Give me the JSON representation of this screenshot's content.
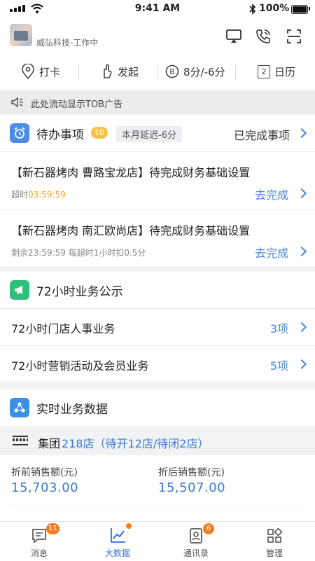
{
  "status_bar": {
    "time": "9:41 AM",
    "battery": "100%"
  },
  "header": {
    "company_status": "威弘科技-工作中"
  },
  "quick_actions": [
    {
      "label": "打卡",
      "icon": "location-pin-icon"
    },
    {
      "label": "发起",
      "icon": "hand-up-icon"
    },
    {
      "label": "8分/-6分",
      "icon": "score-coin-icon"
    },
    {
      "label": "日历",
      "icon": "calendar-icon"
    }
  ],
  "calendar_day": "2",
  "notice": {
    "text": "此处流动显示TOB广告"
  },
  "todo": {
    "title": "待办事项",
    "count": "10",
    "delay_tag": "本月延迟-6分",
    "completed_link": "已完成事项",
    "items": [
      {
        "title": "【新石器烤肉 曹路宝龙店】待完成财务基础设置",
        "status_prefix": "超时",
        "status_time": "03:59:59",
        "status_suffix": "",
        "action": "去完成"
      },
      {
        "title": "【新石器烤肉 南汇欧尚店】待完成财务基础设置",
        "status_prefix": "剩余23:59:59 每超时1小时扣0.5分",
        "status_time": "",
        "status_suffix": "",
        "action": "去完成"
      }
    ]
  },
  "announcement": {
    "title": "72小时业务公示",
    "items": [
      {
        "label": "72小时门店人事业务",
        "count": "3项"
      },
      {
        "label": "72小时营销活动及会员业务",
        "count": "5项"
      }
    ]
  },
  "realtime": {
    "title": "实时业务数据",
    "group_prefix": "集团",
    "group_stores": "218店（待开12店/待闭2店）",
    "metrics": [
      {
        "label": "折前销售额(元)",
        "value": "15,703.00"
      },
      {
        "label": "折后销售额(元)",
        "value": "15,507.00"
      }
    ]
  },
  "tabbar": [
    {
      "label": "消息",
      "badge": "11",
      "icon": "message-icon"
    },
    {
      "label": "大数据",
      "badge": "",
      "icon": "chart-trend-icon"
    },
    {
      "label": "通讯录",
      "badge": "6",
      "icon": "contacts-icon"
    },
    {
      "label": "管理",
      "badge": "",
      "icon": "grid-manage-icon"
    }
  ],
  "colors": {
    "accent": "#2f6fdc",
    "link": "#4a86d9",
    "orange": "#f5a623",
    "badge": "#f57c1f"
  }
}
